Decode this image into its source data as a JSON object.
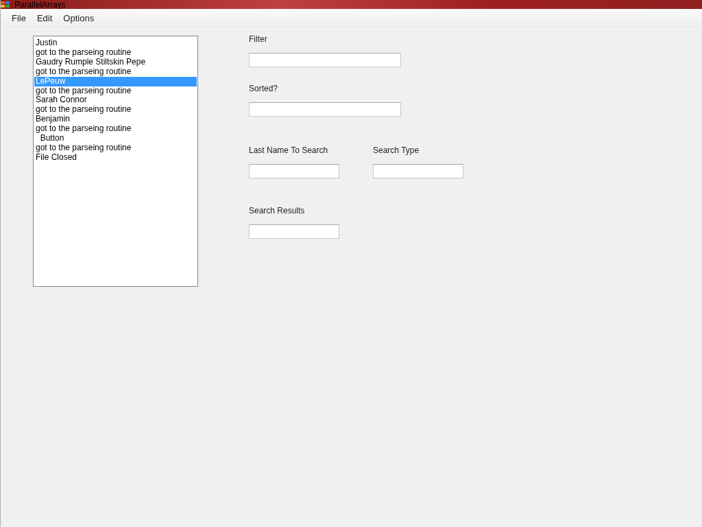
{
  "window": {
    "title": "ParallelArrays"
  },
  "menu": [
    {
      "label": "File"
    },
    {
      "label": "Edit"
    },
    {
      "label": "Options"
    }
  ],
  "log_list": {
    "items": [
      {
        "text": "Justin",
        "selected": false
      },
      {
        "text": "got to the parseing routine",
        "selected": false
      },
      {
        "text": "Gaudry Rumple Stiltskin Pepe",
        "selected": false
      },
      {
        "text": "got to the parseing routine",
        "selected": false
      },
      {
        "text": "LePeuw",
        "selected": true
      },
      {
        "text": "got to the parseing routine",
        "selected": false
      },
      {
        "text": "Sarah Connor",
        "selected": false
      },
      {
        "text": "got to the parseing routine",
        "selected": false
      },
      {
        "text": "Benjamin",
        "selected": false
      },
      {
        "text": "got to the parseing routine",
        "selected": false
      },
      {
        "text": "  Button",
        "selected": false
      },
      {
        "text": "got to the parseing routine",
        "selected": false
      },
      {
        "text": "File Closed",
        "selected": false
      }
    ]
  },
  "fields": {
    "filter": {
      "label": "Filter"
    },
    "sorted": {
      "label": "Sorted?"
    },
    "last_name": {
      "label": "Last Name To Search"
    },
    "search_type": {
      "label": "Search Type"
    },
    "search_results": {
      "label": "Search Results"
    }
  }
}
